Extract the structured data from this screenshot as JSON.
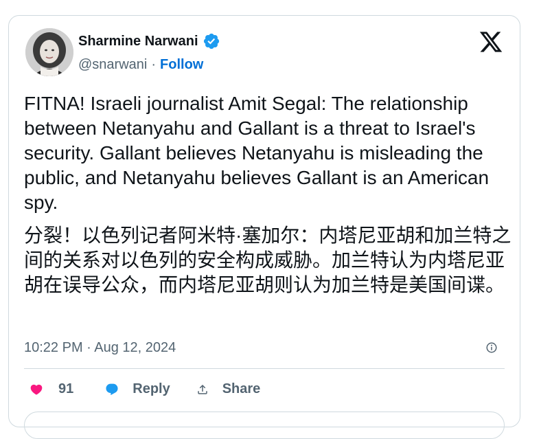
{
  "author": {
    "name": "Sharmine Narwani",
    "handle": "@snarwani",
    "separator": "·",
    "follow_label": "Follow"
  },
  "tweet": {
    "text_en": "FITNA! Israeli journalist Amit Segal: The relationship between Netanyahu and Gallant is a threat to Israel's security. Gallant believes Netanyahu is misleading the public, and Netanyahu believes Gallant is an American spy.",
    "text_zh": "分裂！以色列记者阿米特·塞加尔：内塔尼亚胡和加兰特之间的关系对以色列的安全构成威胁。加兰特认为内塔尼亚胡在误导公众，而内塔尼亚胡则认为加兰特是美国间谍。",
    "timestamp": "10:22 PM · Aug 12, 2024"
  },
  "actions": {
    "like_count": "91",
    "reply_label": "Reply",
    "share_label": "Share"
  },
  "colors": {
    "link_blue": "#006fd6",
    "like_pink": "#f91880",
    "reply_blue": "#1d9bf0",
    "verified_blue": "#1d9bf0",
    "secondary_text": "#536471"
  },
  "icons": {
    "brand": "x-logo-icon",
    "verified": "verified-badge-icon",
    "info": "info-icon",
    "like": "heart-icon",
    "reply": "speech-bubble-icon",
    "share": "share-upload-icon"
  }
}
